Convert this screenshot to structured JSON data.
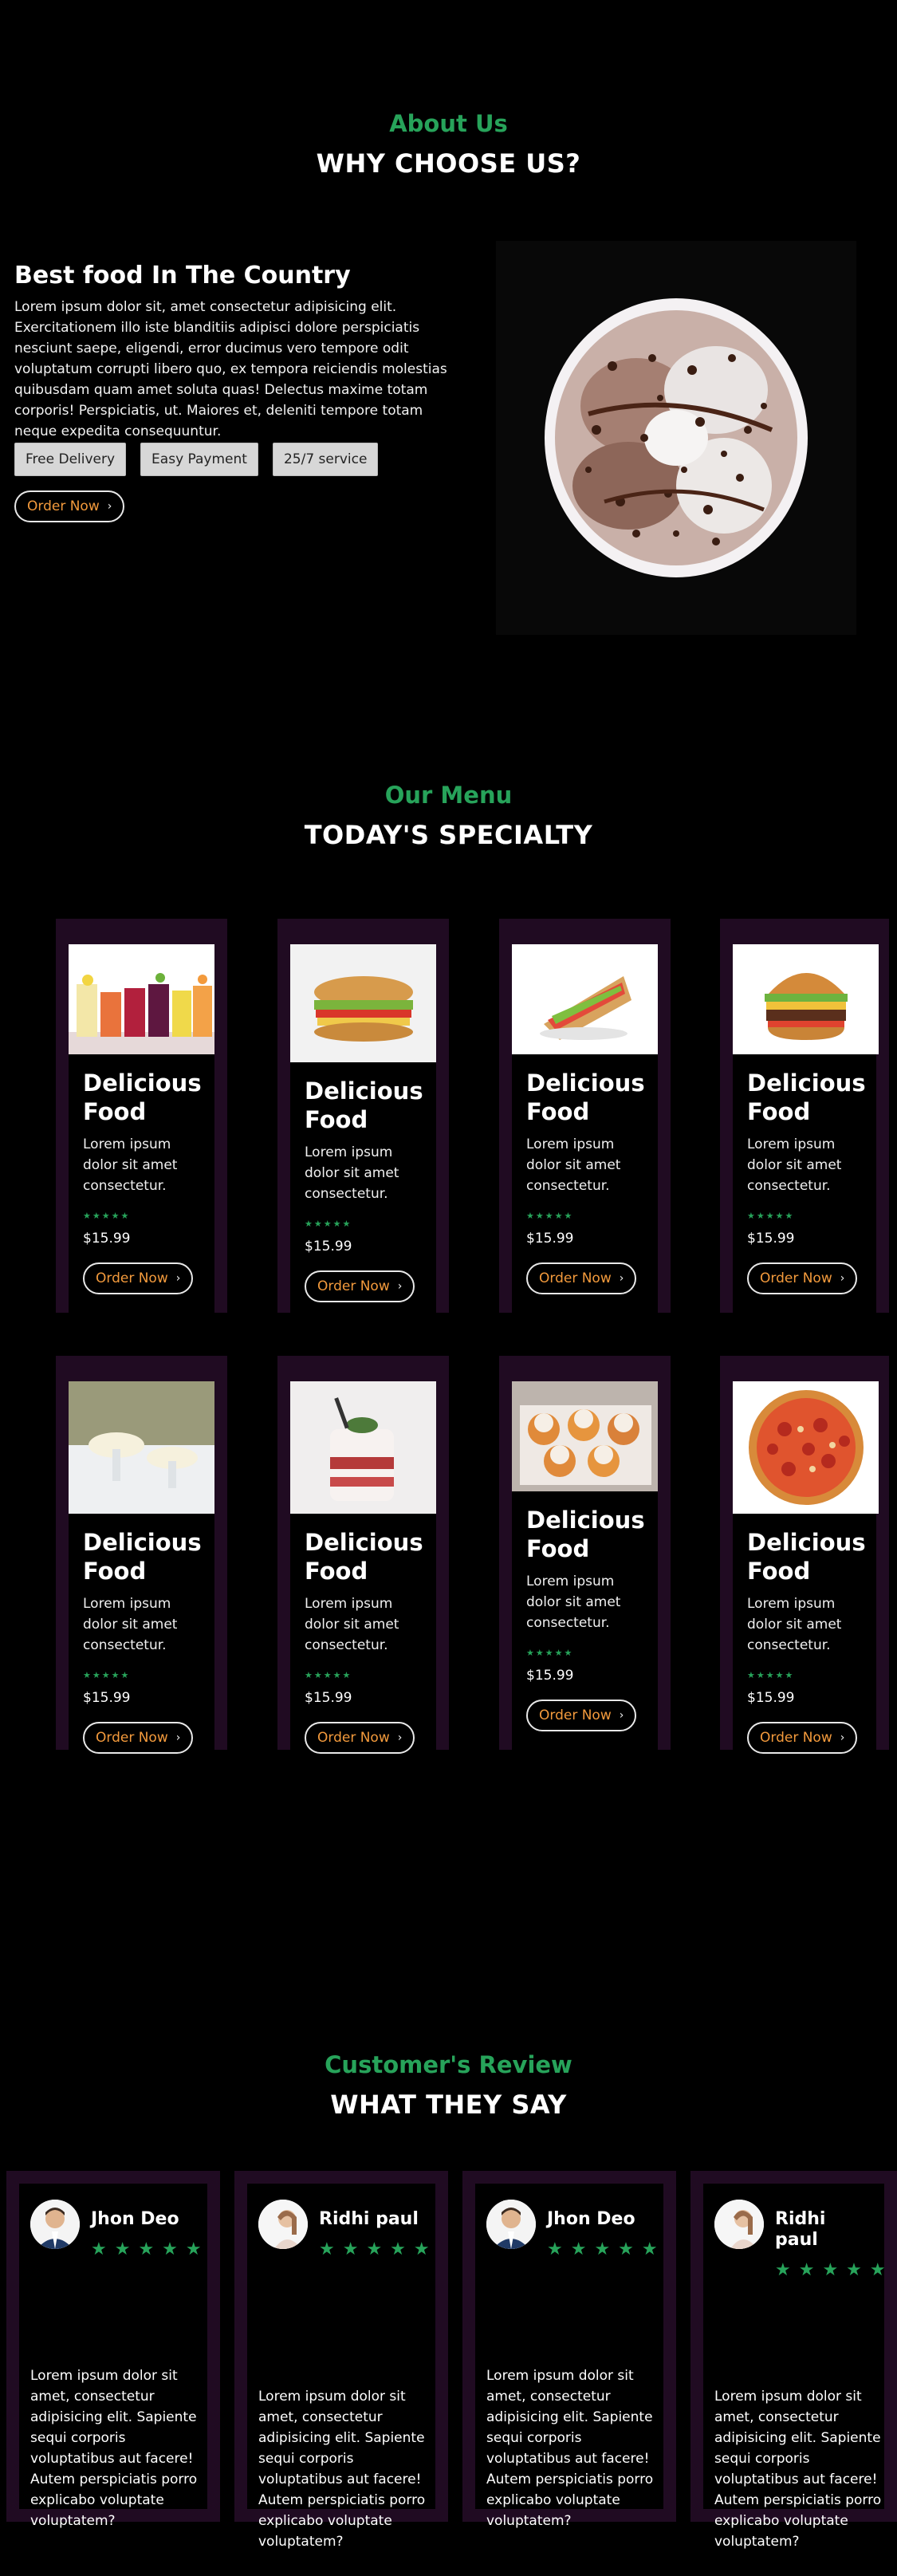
{
  "about": {
    "kicker": "About Us",
    "heading": "WHY CHOOSE US?",
    "title": "Best food In The Country",
    "text": "Lorem ipsum dolor sit, amet consectetur adipisicing elit. Exercitationem illo iste blanditiis adipisci dolore perspiciatis nesciunt saepe, eligendi, error ducimus vero tempore odit voluptatum corrupti libero quo, ex tempora reiciendis molestias quibusdam quam amet soluta quas! Delectus maxime totam corporis! Perspiciatis, ut. Maiores et, deleniti tempore totam neque expedita consequuntur.",
    "features": [
      "Free Delivery",
      "Easy Payment",
      "25/7 service"
    ],
    "order_label": "Order Now",
    "image_label": "ice-cream bowl"
  },
  "menu": {
    "kicker": "Our Menu",
    "heading": "TODAY'S SPECIALTY",
    "items": [
      {
        "title": "Delicious Food",
        "desc": "Lorem ipsum dolor sit amet consectetur.",
        "stars": "★★★★★",
        "price": "$15.99",
        "order": "Order Now",
        "image": "juices"
      },
      {
        "title": "Delicious Food",
        "desc": "Lorem ipsum dolor sit amet consectetur.",
        "stars": "★★★★★",
        "price": "$15.99",
        "order": "Order Now",
        "image": "sandwich"
      },
      {
        "title": "Delicious Food",
        "desc": "Lorem ipsum dolor sit amet consectetur.",
        "stars": "★★★★★",
        "price": "$15.99",
        "order": "Order Now",
        "image": "club-sandwich"
      },
      {
        "title": "Delicious Food",
        "desc": "Lorem ipsum dolor sit amet consectetur.",
        "stars": "★★★★★",
        "price": "$15.99",
        "order": "Order Now",
        "image": "burger"
      },
      {
        "title": "Delicious Food",
        "desc": "Lorem ipsum dolor sit amet consectetur.",
        "stars": "★★★★★",
        "price": "$15.99",
        "order": "Order Now",
        "image": "ice-cream-glasses"
      },
      {
        "title": "Delicious Food",
        "desc": "Lorem ipsum dolor sit amet consectetur.",
        "stars": "★★★★★",
        "price": "$15.99",
        "order": "Order Now",
        "image": "dessert-cup"
      },
      {
        "title": "Delicious Food",
        "desc": "Lorem ipsum dolor sit amet consectetur.",
        "stars": "★★★★★",
        "price": "$15.99",
        "order": "Order Now",
        "image": "peach-scoops"
      },
      {
        "title": "Delicious Food",
        "desc": "Lorem ipsum dolor sit amet consectetur.",
        "stars": "★★★★★",
        "price": "$15.99",
        "order": "Order Now",
        "image": "pizza"
      }
    ]
  },
  "reviews": {
    "kicker": "Customer's Review",
    "heading": "WHAT THEY SAY",
    "items": [
      {
        "name": "Jhon Deo",
        "stars": "★★★★★",
        "text": "Lorem ipsum dolor sit amet, consectetur adipisicing elit. Sapiente sequi corporis voluptatibus aut facere! Autem perspiciatis porro explicabo voluptate voluptatem?",
        "avatar": "man-avatar"
      },
      {
        "name": "Ridhi paul",
        "stars": "★★★★★",
        "text": "Lorem ipsum dolor sit amet, consectetur adipisicing elit. Sapiente sequi corporis voluptatibus aut facere! Autem perspiciatis porro explicabo voluptate voluptatem?",
        "avatar": "woman-avatar"
      },
      {
        "name": "Jhon Deo",
        "stars": "★★★★★",
        "text": "Lorem ipsum dolor sit amet, consectetur adipisicing elit. Sapiente sequi corporis voluptatibus aut facere! Autem perspiciatis porro explicabo voluptate voluptatem?",
        "avatar": "man-avatar"
      },
      {
        "name": "Ridhi paul",
        "stars": "★★★★★",
        "text": "Lorem ipsum dolor sit amet, consectetur adipisicing elit. Sapiente sequi corporis voluptatibus aut facere! Autem perspiciatis porro explicabo voluptate voluptatem?",
        "avatar": "woman-avatar"
      }
    ]
  },
  "colors": {
    "accent_green": "#27a35a",
    "order_text": "#f39a3c",
    "card_frame": "#200b22"
  }
}
